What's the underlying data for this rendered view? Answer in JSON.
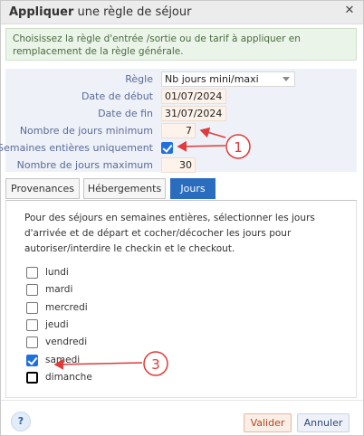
{
  "dialog": {
    "title_bold": "Appliquer",
    "title_rest": " une règle de séjour",
    "close_icon": "close-icon",
    "info_text": "Choisissez la règle d'entrée /sortie ou de tarif à appliquer en remplacement de la règle générale."
  },
  "form": {
    "regle_label": "Règle",
    "regle_value": "Nb jours mini/maxi",
    "date_debut_label": "Date de début",
    "date_debut_value": "01/07/2024",
    "date_fin_label": "Date de fin",
    "date_fin_value": "31/07/2024",
    "min_label": "Nombre de jours minimum",
    "min_value": "7",
    "semaines_label": "Semaines entières uniquement",
    "semaines_checked": true,
    "max_label": "Nombre de jours maximum",
    "max_value": "30"
  },
  "tabs": [
    {
      "label": "Provenances",
      "active": false
    },
    {
      "label": "Hébergements",
      "active": false
    },
    {
      "label": "Jours",
      "active": true
    }
  ],
  "panel": {
    "description": "Pour des séjours en semaines entières, sélectionner les jours d'arrivée et de départ et cocher/décocher les jours pour autoriser/interdire le checkin et le checkout.",
    "days": [
      {
        "label": "lundi",
        "checked": false
      },
      {
        "label": "mardi",
        "checked": false
      },
      {
        "label": "mercredi",
        "checked": false
      },
      {
        "label": "jeudi",
        "checked": false
      },
      {
        "label": "vendredi",
        "checked": false
      },
      {
        "label": "samedi",
        "checked": true
      },
      {
        "label": "dimanche",
        "checked": false,
        "focused": true
      }
    ]
  },
  "footer": {
    "help_label": "?",
    "ok_label": "Valider",
    "cancel_label": "Annuler"
  },
  "annotations": {
    "marker_1": "1",
    "marker_3": "3",
    "color": "#e03a3a"
  }
}
